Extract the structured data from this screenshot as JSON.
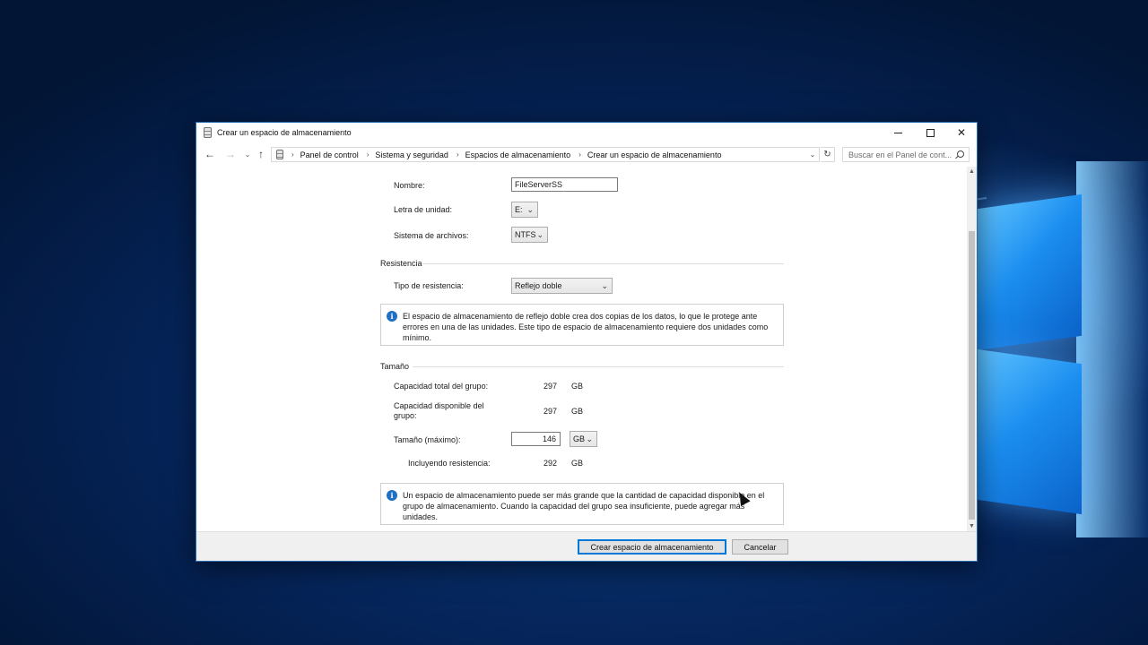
{
  "window": {
    "title": "Crear un espacio de almacenamiento",
    "controls": {
      "minimize": "—",
      "maximize": "□",
      "close": "✕"
    }
  },
  "navigation": {
    "back_icon": "←",
    "forward_icon": "→",
    "recent_icon": "⌄",
    "up_icon": "↑",
    "breadcrumbs": [
      "Panel de control",
      "Sistema y seguridad",
      "Espacios de almacenamiento",
      "Crear un espacio de almacenamiento"
    ],
    "separator": "›",
    "dropdown_icon": "⌄",
    "refresh_icon": "↻",
    "search_placeholder": "Buscar en el Panel de cont..."
  },
  "form": {
    "name_label": "Nombre:",
    "name_value": "FileServerSS",
    "drive_letter_label": "Letra de unidad:",
    "drive_letter_value": "E:",
    "file_system_label": "Sistema de archivos:",
    "file_system_value": "NTFS",
    "resiliency": {
      "heading": "Resistencia",
      "type_label": "Tipo de resistencia:",
      "type_value": "Reflejo doble",
      "info": "El espacio de almacenamiento de reflejo doble crea dos copias de los datos, lo que le protege ante errores en una de las unidades. Este tipo de espacio de almacenamiento requiere dos unidades como mínimo."
    },
    "size": {
      "heading": "Tamaño",
      "total_label": "Capacidad total del grupo:",
      "total_value": "297",
      "total_unit": "GB",
      "available_label": "Capacidad disponible del grupo:",
      "available_value": "297",
      "available_unit": "GB",
      "max_label": "Tamaño (máximo):",
      "max_value": "146",
      "max_unit": "GB",
      "including_label": "Incluyendo resistencia:",
      "including_value": "292",
      "including_unit": "GB",
      "info": "Un espacio de almacenamiento puede ser más grande que la cantidad de capacidad disponible en el grupo de almacenamiento. Cuando la capacidad del grupo sea insuficiente, puede agregar más unidades."
    }
  },
  "footer": {
    "create_button": "Crear espacio de almacenamiento",
    "cancel_button": "Cancelar"
  },
  "scrollbar": {
    "up": "▲",
    "down": "▼"
  },
  "colors": {
    "accent": "#0078d7",
    "info_icon": "#1f6fc5",
    "desktop": "#052459"
  }
}
